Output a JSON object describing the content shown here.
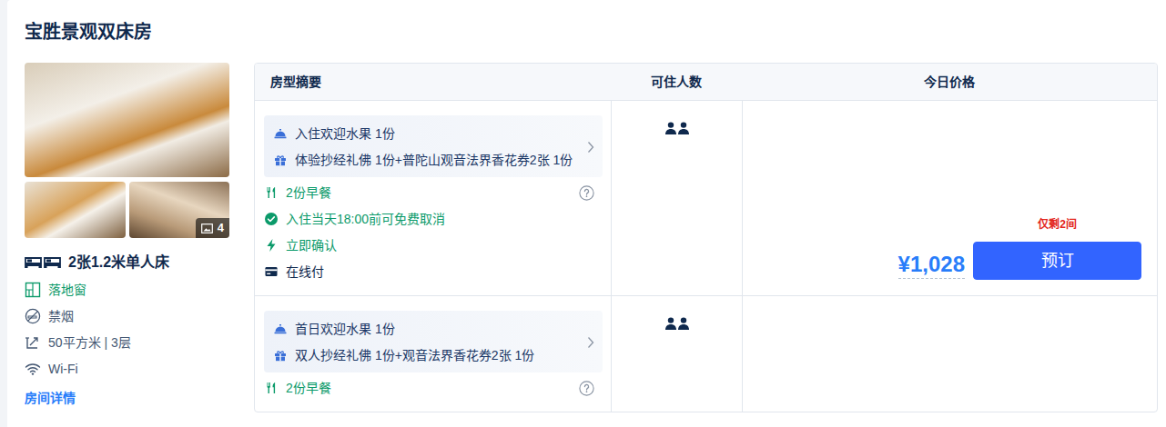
{
  "title": "宝胜景观双床房",
  "gallery": {
    "photo_count": "4"
  },
  "room": {
    "bed": "2张1.2米单人床",
    "features": [
      {
        "text": "落地窗",
        "kind": "window",
        "color": "#0b9a6a"
      },
      {
        "text": "禁烟",
        "kind": "nosmoking",
        "color": "#455873"
      },
      {
        "text": "50平方米 | 3层",
        "kind": "area",
        "color": "#455873"
      },
      {
        "text": "Wi-Fi",
        "kind": "wifi",
        "color": "#455873"
      }
    ],
    "details_link": "房间详情"
  },
  "table": {
    "columns": [
      "房型摘要",
      "可住人数",
      "今日价格"
    ],
    "rows": [
      {
        "perks": [
          {
            "kind": "fruit",
            "text": "入住欢迎水果 1份"
          },
          {
            "kind": "gift",
            "text": "体验抄经礼佛 1份+普陀山观音法界香花券2张 1份"
          }
        ],
        "policies": [
          {
            "kind": "breakfast",
            "text": "2份早餐",
            "color": "#0b9a6a",
            "help": true
          },
          {
            "kind": "cancel",
            "text": "入住当天18:00前可免费取消",
            "color": "#0b9a6a",
            "help": false
          },
          {
            "kind": "confirm",
            "text": "立即确认",
            "color": "#0b9a6a",
            "help": false
          },
          {
            "kind": "payment",
            "text": "在线付",
            "color": "#0f294d",
            "help": false
          }
        ],
        "guests": 2,
        "stock": "仅剩2间",
        "price": "¥1,028",
        "button": "预订"
      },
      {
        "perks": [
          {
            "kind": "fruit",
            "text": "首日欢迎水果 1份"
          },
          {
            "kind": "gift",
            "text": "双人抄经礼佛 1份+观音法界香花券2张 1份"
          }
        ],
        "policies": [
          {
            "kind": "breakfast",
            "text": "2份早餐",
            "color": "#0b9a6a",
            "help": true
          }
        ],
        "guests": 2
      }
    ]
  }
}
